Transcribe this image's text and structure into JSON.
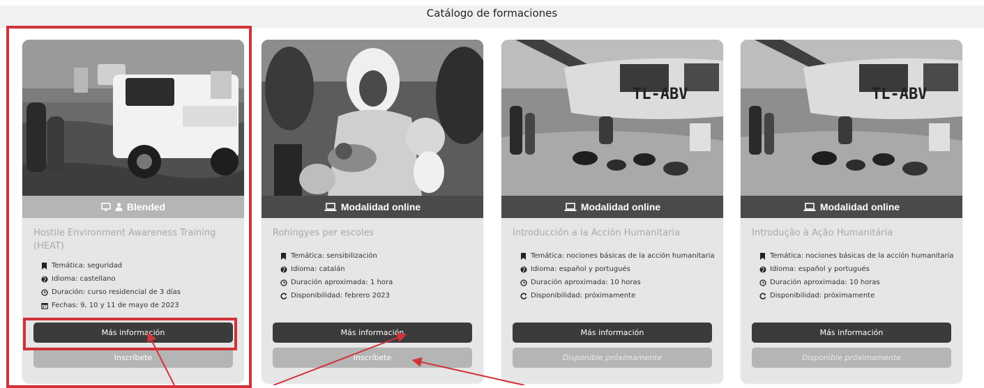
{
  "page": {
    "title": "Catálogo de formaciones"
  },
  "cards": [
    {
      "mode_label": "Blended",
      "mode_icons": [
        "monitor-icon",
        "person-icon"
      ],
      "mode_style": "light",
      "title": "Hostile Environment Awareness Training (HEAT)",
      "details": [
        {
          "icon": "bookmark-icon",
          "text": "Temática: seguridad"
        },
        {
          "icon": "globe-icon",
          "text": "Idioma: castellano"
        },
        {
          "icon": "clock-icon",
          "text": "Duración: curso residencial de 3 días"
        },
        {
          "icon": "calendar-icon",
          "text": "Fechas: 9, 10 y 11 de mayo de 2023"
        }
      ],
      "primary_button": "Más información",
      "secondary_button": "Inscríbete"
    },
    {
      "mode_label": "Modalidad online",
      "mode_icons": [
        "laptop-icon"
      ],
      "mode_style": "dark",
      "title": "Rohingyes per escoles",
      "details": [
        {
          "icon": "bookmark-icon",
          "text": "Temática: sensibilización"
        },
        {
          "icon": "globe-icon",
          "text": "Idioma: catalán"
        },
        {
          "icon": "clock-icon",
          "text": "Duración aproximada: 1 hora"
        },
        {
          "icon": "refresh-icon",
          "text": "Disponibilidad: febrero 2023"
        }
      ],
      "primary_button": "Más información",
      "secondary_button": "Inscríbete"
    },
    {
      "mode_label": "Modalidad online",
      "mode_icons": [
        "laptop-icon"
      ],
      "mode_style": "dark",
      "title": "Introducción a la Acción Humanitaria",
      "details": [
        {
          "icon": "bookmark-icon",
          "text": "Temática: nociones básicas de la acción humanitaria"
        },
        {
          "icon": "globe-icon",
          "text": "Idioma: español y portugués"
        },
        {
          "icon": "clock-icon",
          "text": "Duración aproximada: 10 horas"
        },
        {
          "icon": "refresh-icon",
          "text": "Disponibilidad: próximamente"
        }
      ],
      "primary_button": "Más información",
      "secondary_button": "Disponible próximamente"
    },
    {
      "mode_label": "Modalidad online",
      "mode_icons": [
        "laptop-icon"
      ],
      "mode_style": "dark",
      "title": "Introdução à Ação Humanitária",
      "details": [
        {
          "icon": "bookmark-icon",
          "text": "Temática: nociones básicas de la acción humanitaria"
        },
        {
          "icon": "globe-icon",
          "text": "Idioma: español y portugués"
        },
        {
          "icon": "clock-icon",
          "text": "Duración aproximada: 10 horas"
        },
        {
          "icon": "refresh-icon",
          "text": "Disponibilidad: próximamente"
        }
      ],
      "primary_button": "Más información",
      "secondary_button": "Disponible próximamente"
    }
  ],
  "plane_registration": "TL-ABV",
  "colors": {
    "highlight": "#d0333a",
    "mode_bar_dark": "#4a4a4a",
    "mode_bar_light": "#b5b5b5",
    "button_primary": "#3b3b3b",
    "button_disabled": "#b5b5b5",
    "card_background": "#e6e6e6"
  }
}
